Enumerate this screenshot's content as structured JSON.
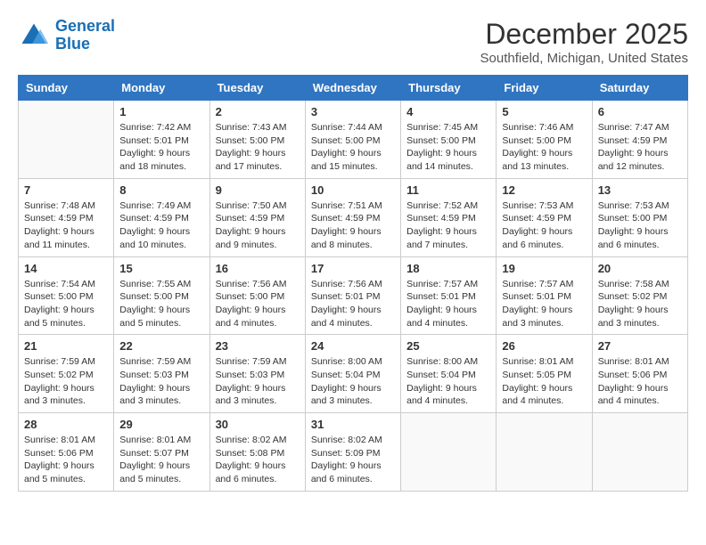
{
  "header": {
    "logo_line1": "General",
    "logo_line2": "Blue",
    "month": "December 2025",
    "location": "Southfield, Michigan, United States"
  },
  "days_of_week": [
    "Sunday",
    "Monday",
    "Tuesday",
    "Wednesday",
    "Thursday",
    "Friday",
    "Saturday"
  ],
  "weeks": [
    [
      {
        "num": "",
        "detail": ""
      },
      {
        "num": "1",
        "detail": "Sunrise: 7:42 AM\nSunset: 5:01 PM\nDaylight: 9 hours\nand 18 minutes."
      },
      {
        "num": "2",
        "detail": "Sunrise: 7:43 AM\nSunset: 5:00 PM\nDaylight: 9 hours\nand 17 minutes."
      },
      {
        "num": "3",
        "detail": "Sunrise: 7:44 AM\nSunset: 5:00 PM\nDaylight: 9 hours\nand 15 minutes."
      },
      {
        "num": "4",
        "detail": "Sunrise: 7:45 AM\nSunset: 5:00 PM\nDaylight: 9 hours\nand 14 minutes."
      },
      {
        "num": "5",
        "detail": "Sunrise: 7:46 AM\nSunset: 5:00 PM\nDaylight: 9 hours\nand 13 minutes."
      },
      {
        "num": "6",
        "detail": "Sunrise: 7:47 AM\nSunset: 4:59 PM\nDaylight: 9 hours\nand 12 minutes."
      }
    ],
    [
      {
        "num": "7",
        "detail": "Sunrise: 7:48 AM\nSunset: 4:59 PM\nDaylight: 9 hours\nand 11 minutes."
      },
      {
        "num": "8",
        "detail": "Sunrise: 7:49 AM\nSunset: 4:59 PM\nDaylight: 9 hours\nand 10 minutes."
      },
      {
        "num": "9",
        "detail": "Sunrise: 7:50 AM\nSunset: 4:59 PM\nDaylight: 9 hours\nand 9 minutes."
      },
      {
        "num": "10",
        "detail": "Sunrise: 7:51 AM\nSunset: 4:59 PM\nDaylight: 9 hours\nand 8 minutes."
      },
      {
        "num": "11",
        "detail": "Sunrise: 7:52 AM\nSunset: 4:59 PM\nDaylight: 9 hours\nand 7 minutes."
      },
      {
        "num": "12",
        "detail": "Sunrise: 7:53 AM\nSunset: 4:59 PM\nDaylight: 9 hours\nand 6 minutes."
      },
      {
        "num": "13",
        "detail": "Sunrise: 7:53 AM\nSunset: 5:00 PM\nDaylight: 9 hours\nand 6 minutes."
      }
    ],
    [
      {
        "num": "14",
        "detail": "Sunrise: 7:54 AM\nSunset: 5:00 PM\nDaylight: 9 hours\nand 5 minutes."
      },
      {
        "num": "15",
        "detail": "Sunrise: 7:55 AM\nSunset: 5:00 PM\nDaylight: 9 hours\nand 5 minutes."
      },
      {
        "num": "16",
        "detail": "Sunrise: 7:56 AM\nSunset: 5:00 PM\nDaylight: 9 hours\nand 4 minutes."
      },
      {
        "num": "17",
        "detail": "Sunrise: 7:56 AM\nSunset: 5:01 PM\nDaylight: 9 hours\nand 4 minutes."
      },
      {
        "num": "18",
        "detail": "Sunrise: 7:57 AM\nSunset: 5:01 PM\nDaylight: 9 hours\nand 4 minutes."
      },
      {
        "num": "19",
        "detail": "Sunrise: 7:57 AM\nSunset: 5:01 PM\nDaylight: 9 hours\nand 3 minutes."
      },
      {
        "num": "20",
        "detail": "Sunrise: 7:58 AM\nSunset: 5:02 PM\nDaylight: 9 hours\nand 3 minutes."
      }
    ],
    [
      {
        "num": "21",
        "detail": "Sunrise: 7:59 AM\nSunset: 5:02 PM\nDaylight: 9 hours\nand 3 minutes."
      },
      {
        "num": "22",
        "detail": "Sunrise: 7:59 AM\nSunset: 5:03 PM\nDaylight: 9 hours\nand 3 minutes."
      },
      {
        "num": "23",
        "detail": "Sunrise: 7:59 AM\nSunset: 5:03 PM\nDaylight: 9 hours\nand 3 minutes."
      },
      {
        "num": "24",
        "detail": "Sunrise: 8:00 AM\nSunset: 5:04 PM\nDaylight: 9 hours\nand 3 minutes."
      },
      {
        "num": "25",
        "detail": "Sunrise: 8:00 AM\nSunset: 5:04 PM\nDaylight: 9 hours\nand 4 minutes."
      },
      {
        "num": "26",
        "detail": "Sunrise: 8:01 AM\nSunset: 5:05 PM\nDaylight: 9 hours\nand 4 minutes."
      },
      {
        "num": "27",
        "detail": "Sunrise: 8:01 AM\nSunset: 5:06 PM\nDaylight: 9 hours\nand 4 minutes."
      }
    ],
    [
      {
        "num": "28",
        "detail": "Sunrise: 8:01 AM\nSunset: 5:06 PM\nDaylight: 9 hours\nand 5 minutes."
      },
      {
        "num": "29",
        "detail": "Sunrise: 8:01 AM\nSunset: 5:07 PM\nDaylight: 9 hours\nand 5 minutes."
      },
      {
        "num": "30",
        "detail": "Sunrise: 8:02 AM\nSunset: 5:08 PM\nDaylight: 9 hours\nand 6 minutes."
      },
      {
        "num": "31",
        "detail": "Sunrise: 8:02 AM\nSunset: 5:09 PM\nDaylight: 9 hours\nand 6 minutes."
      },
      {
        "num": "",
        "detail": ""
      },
      {
        "num": "",
        "detail": ""
      },
      {
        "num": "",
        "detail": ""
      }
    ]
  ]
}
